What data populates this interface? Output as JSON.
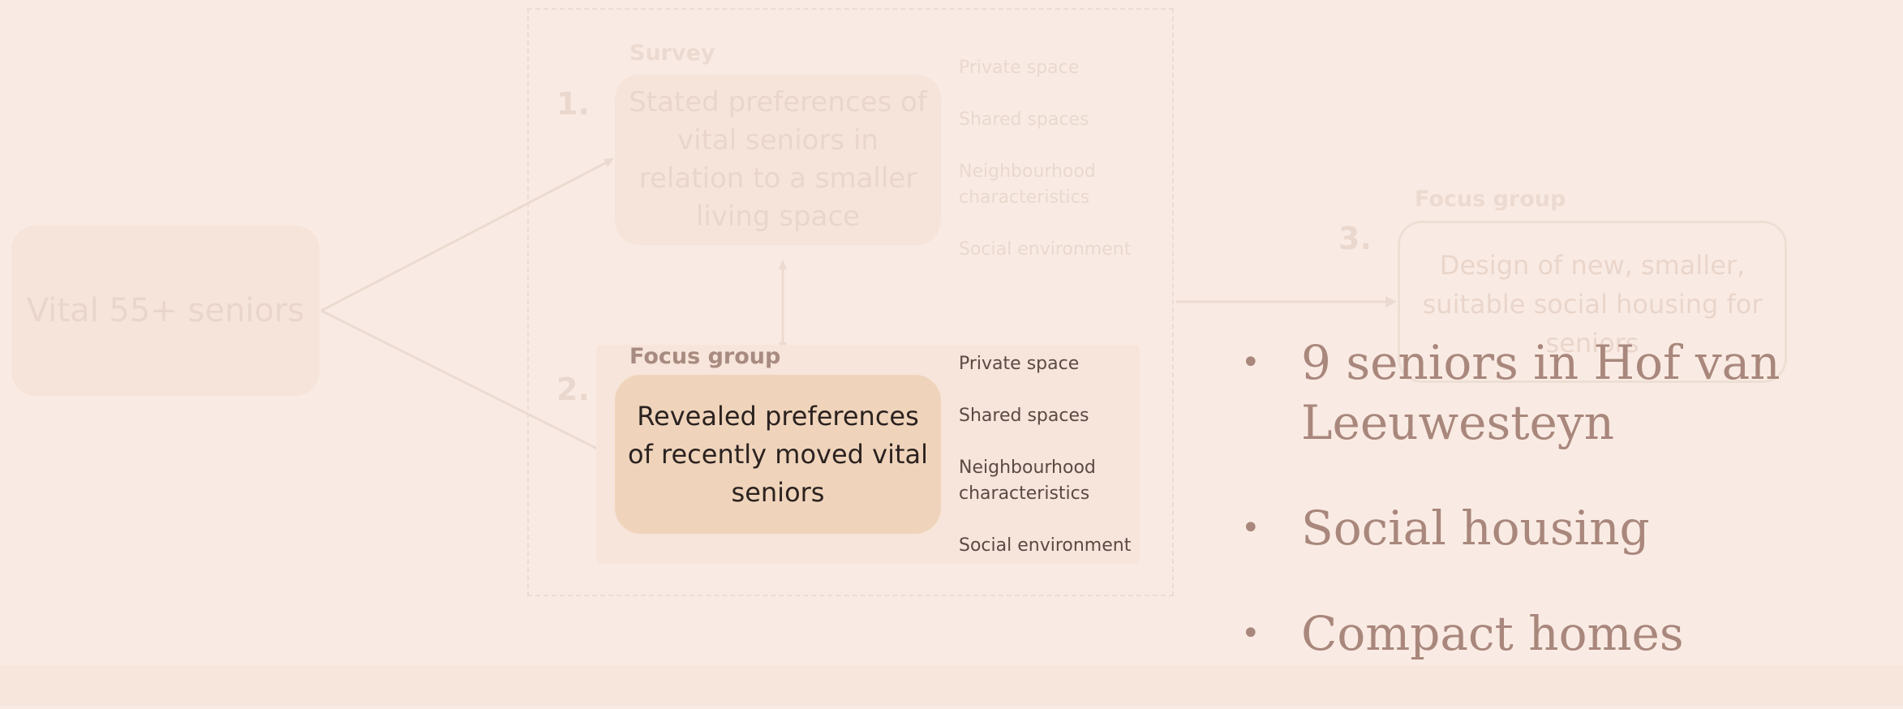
{
  "diagram": {
    "source": {
      "label": "Vital 55+ seniors"
    },
    "steps": [
      {
        "number": "1.",
        "method": "Survey",
        "box": "Stated preferences of vital seniors in relation to a smaller living space"
      },
      {
        "number": "2.",
        "method": "Focus group",
        "box": "Revealed preferences of recently moved vital seniors"
      },
      {
        "number": "3.",
        "method": "Focus group",
        "box": "Design of new, smaller, suitable social housing for seniors"
      }
    ],
    "attributes_step1": [
      "Private space",
      "Shared spaces",
      "Neighbourhood characteristics",
      "Social environment"
    ],
    "attributes_step2": [
      "Private space",
      "Shared spaces",
      "Neighbourhood characteristics",
      "Social environment"
    ]
  },
  "bullets": [
    "9 seniors in Hof van Leeuwesteyn",
    "Social housing",
    "Compact homes"
  ],
  "colors": {
    "background": "#f9ebe3",
    "highlight_box": "#efd4bb",
    "bullet_text": "#a9877c"
  }
}
